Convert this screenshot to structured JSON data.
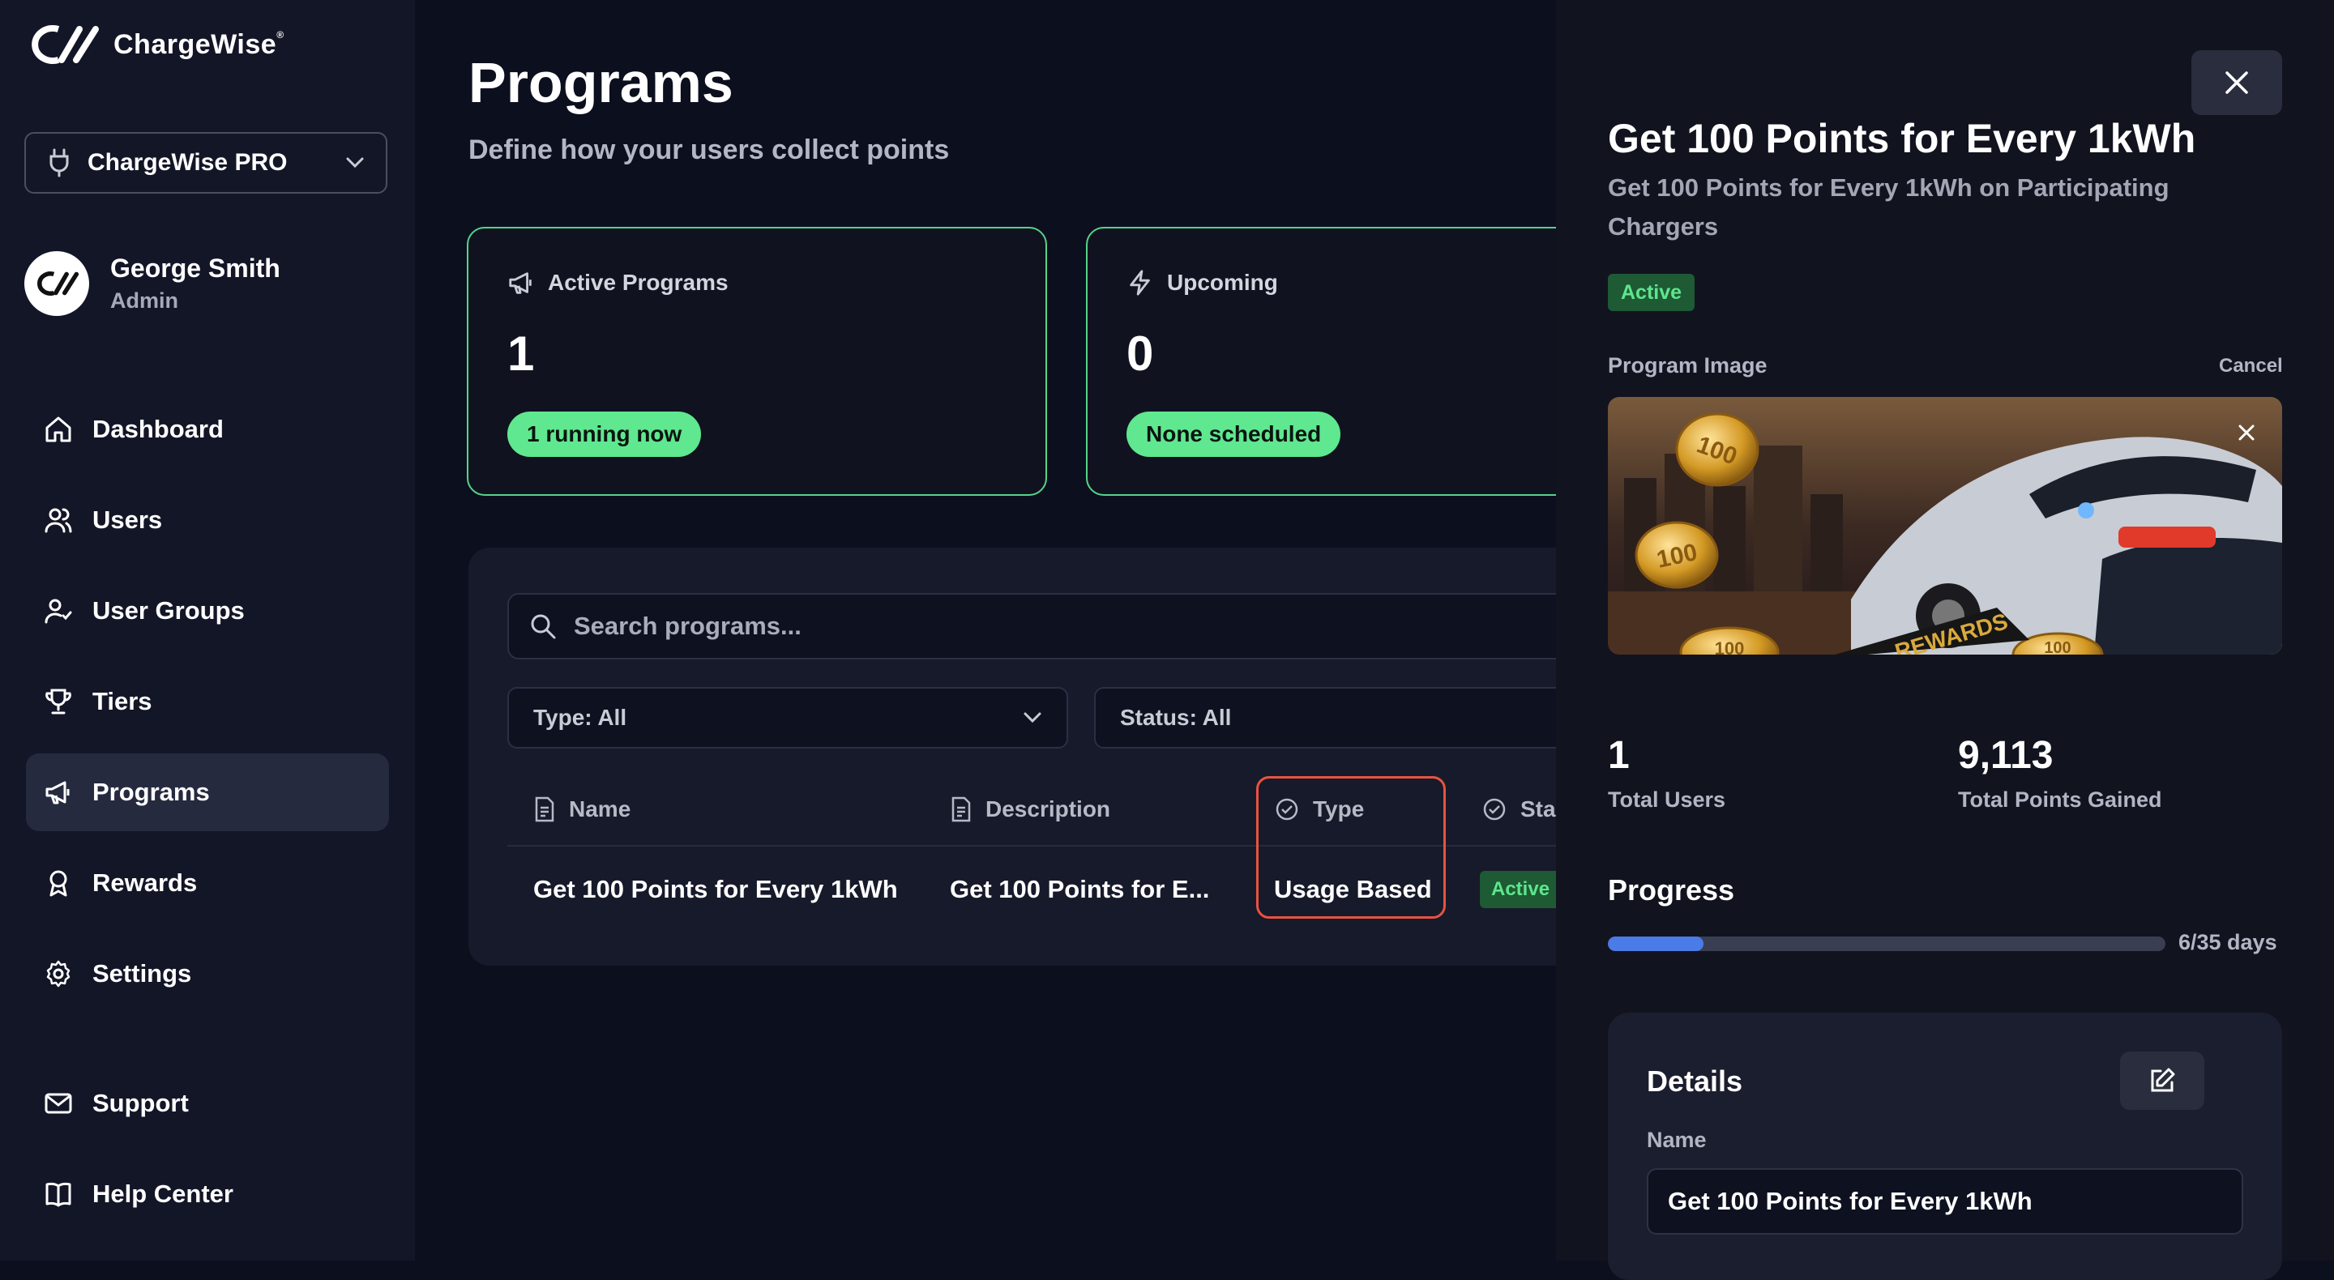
{
  "app": {
    "name": "ChargeWise",
    "mark": "®"
  },
  "org": {
    "selected": "ChargeWise PRO"
  },
  "user": {
    "name": "George Smith",
    "role": "Admin"
  },
  "nav": [
    {
      "label": "Dashboard",
      "icon": "home-icon"
    },
    {
      "label": "Users",
      "icon": "users-icon"
    },
    {
      "label": "User Groups",
      "icon": "user-groups-icon"
    },
    {
      "label": "Tiers",
      "icon": "trophy-icon"
    },
    {
      "label": "Programs",
      "icon": "megaphone-icon",
      "active": true
    },
    {
      "label": "Rewards",
      "icon": "award-icon"
    },
    {
      "label": "Settings",
      "icon": "gear-icon"
    },
    {
      "label": "Support",
      "icon": "mail-icon"
    },
    {
      "label": "Help Center",
      "icon": "book-icon"
    }
  ],
  "page": {
    "title": "Programs",
    "subtitle": "Define how your users collect points"
  },
  "stats": [
    {
      "label": "Active Programs",
      "value": "1",
      "pill": "1 running now",
      "icon": "megaphone-icon"
    },
    {
      "label": "Upcoming",
      "value": "0",
      "pill": "None scheduled",
      "icon": "lightning-icon"
    }
  ],
  "search": {
    "placeholder": "Search programs..."
  },
  "filters": {
    "type": "Type: All",
    "status": "Status: All"
  },
  "table": {
    "columns": [
      "Name",
      "Description",
      "Type",
      "Sta"
    ],
    "rows": [
      {
        "name": "Get 100 Points for Every 1kWh",
        "description": "Get 100 Points for E...",
        "type": "Usage Based",
        "status": "Active"
      }
    ]
  },
  "drawer": {
    "title": "Get 100 Points for Every 1kWh",
    "subtitle": "Get 100 Points for Every 1kWh on Participating Chargers",
    "status": "Active",
    "image_label": "Program Image",
    "cancel": "Cancel",
    "image_texts": [
      "100",
      "100",
      "100",
      "100",
      "REWARDS"
    ],
    "metrics": [
      {
        "value": "1",
        "label": "Total Users"
      },
      {
        "value": "9,113",
        "label": "Total Points Gained"
      }
    ],
    "progress": {
      "title": "Progress",
      "text": "6/35 days",
      "fraction": 0.1714
    },
    "details": {
      "title": "Details",
      "name_label": "Name",
      "name_value": "Get 100 Points for Every 1kWh"
    }
  },
  "colors": {
    "accent_green": "#5fe88f",
    "highlight_red": "#e8533f",
    "progress_blue": "#4a7be6",
    "background": "#0c0f1e"
  }
}
